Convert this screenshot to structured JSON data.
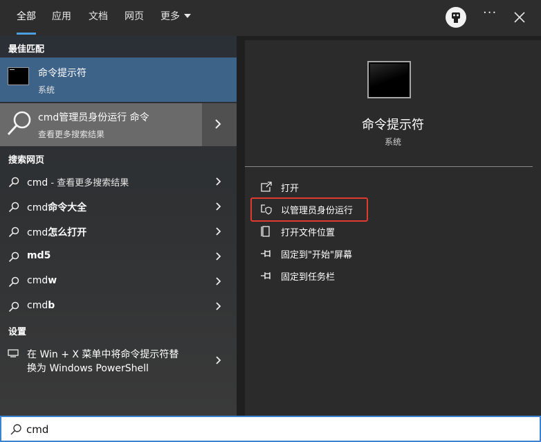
{
  "tabs": [
    {
      "label": "全部"
    },
    {
      "label": "应用"
    },
    {
      "label": "文档"
    },
    {
      "label": "网页"
    },
    {
      "label": "更多"
    }
  ],
  "icons": {
    "avatar": "user-avatar-icon",
    "more": "ellipsis-icon",
    "close": "close-icon",
    "search": "search-icon",
    "chevron": "chevron-right-icon"
  },
  "left": {
    "best_match_title": "最佳匹配",
    "best_match": {
      "name": "命令提示符",
      "type": "系统"
    },
    "cmd_row": {
      "title": "cmd管理员身份运行 命令",
      "subtitle": "查看更多搜索结果"
    },
    "web_title": "搜索网页",
    "web_results": [
      {
        "prefix": "cmd",
        "suffix": " - 查看更多搜索结果"
      },
      {
        "prefix": "cmd",
        "suffix": "命令大全"
      },
      {
        "prefix": "cmd",
        "suffix": "怎么打开"
      },
      {
        "prefix": "",
        "suffix": "md5"
      },
      {
        "prefix": "cmd",
        "suffix": "w"
      },
      {
        "prefix": "cmd",
        "suffix": "b"
      }
    ],
    "settings_title": "设置",
    "setting_item": {
      "line1": "在 Win + X 菜单中将命令提示符替",
      "line2": "换为 Windows PowerShell"
    }
  },
  "right": {
    "app_name": "命令提示符",
    "app_type": "系统",
    "actions": [
      {
        "label": "打开",
        "icon": "open-icon"
      },
      {
        "label": "以管理员身份运行",
        "icon": "shield-icon"
      },
      {
        "label": "打开文件位置",
        "icon": "file-location-icon"
      },
      {
        "label": "固定到\"开始\"屏幕",
        "icon": "pin-icon"
      },
      {
        "label": "固定到任务栏",
        "icon": "pin-icon"
      }
    ]
  },
  "search": {
    "value": "cmd"
  },
  "colors": {
    "accent": "#4c9fe0",
    "selected": "#3e6389",
    "highlight_box": "#e23a2f"
  }
}
